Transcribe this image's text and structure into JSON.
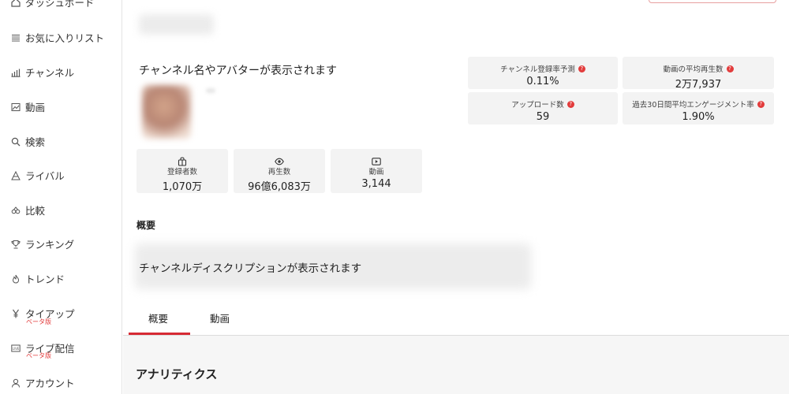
{
  "sidebar": {
    "items": [
      {
        "label": "ダッシュボード",
        "icon": "home-icon"
      },
      {
        "label": "お気に入りリスト",
        "icon": "list-icon"
      },
      {
        "label": "チャンネル",
        "icon": "bar-chart-icon"
      },
      {
        "label": "動画",
        "icon": "image-icon"
      },
      {
        "label": "検索",
        "icon": "search-icon"
      },
      {
        "label": "ライバル",
        "icon": "rival-icon"
      },
      {
        "label": "比較",
        "icon": "compare-icon"
      },
      {
        "label": "ランキング",
        "icon": "trophy-icon"
      },
      {
        "label": "トレンド",
        "icon": "flame-icon"
      },
      {
        "label": "タイアップ",
        "icon": "yen-icon",
        "sub": "ベータ版"
      },
      {
        "label": "ライブ配信",
        "icon": "live-icon",
        "sub": "ベータ版"
      },
      {
        "label": "アカウント",
        "icon": "user-icon"
      }
    ]
  },
  "channel": {
    "name_placeholder": "チャンネル名やアバターが表示されます"
  },
  "stats": [
    {
      "label": "登録者数",
      "value": "1,070万",
      "icon": "bag-icon"
    },
    {
      "label": "再生数",
      "value": "96億6,083万",
      "icon": "eye-icon"
    },
    {
      "label": "動画",
      "value": "3,144",
      "icon": "play-icon"
    }
  ],
  "metrics": [
    {
      "label": "チャンネル登録率予測",
      "value": "0.11%"
    },
    {
      "label": "動画の平均再生数",
      "value": "2万7,937"
    },
    {
      "label": "アップロード数",
      "value": "59"
    },
    {
      "label": "過去30日間平均エンゲージメント率",
      "value": "1.90%"
    }
  ],
  "overview": {
    "title": "概要",
    "description_placeholder": "チャンネルディスクリプションが表示されます"
  },
  "tabs": [
    {
      "label": "概要",
      "active": true
    },
    {
      "label": "動画",
      "active": false
    }
  ],
  "analytics": {
    "title": "アナリティクス"
  },
  "colors": {
    "accent": "#d62a34",
    "help": "#e23b3b",
    "panel": "#f3f3f3"
  }
}
